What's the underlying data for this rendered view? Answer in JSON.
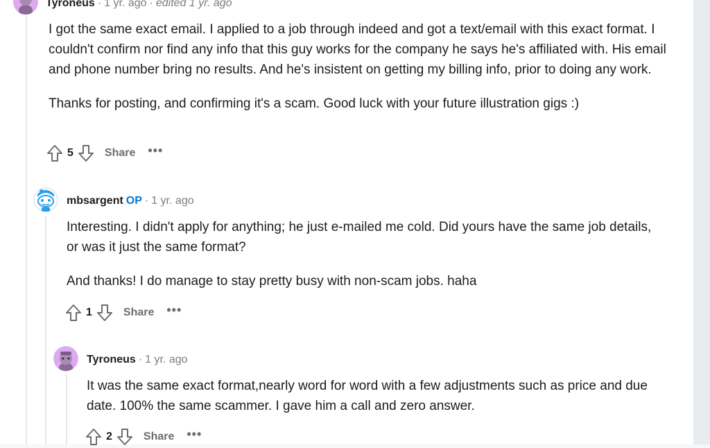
{
  "colors": {
    "accent": "#0079d3",
    "op_badge": "#0079d3",
    "thread_line": "#e5e7ea",
    "avatar_purple": "#ddaaf0"
  },
  "comments": [
    {
      "author": "Tyroneus",
      "time": "1 yr. ago",
      "edited": "edited 1 yr. ago",
      "avatar_icon": "snoo-purple-avatar-icon",
      "paragraphs": [
        "I got the same exact email. I applied to a job through indeed and got a text/email with this exact format. I couldn't confirm nor find any info that this guy works for the company he says he's affiliated with. His email and phone number bring no results. And he's insistent on getting my billing info, prior to doing any work.",
        "Thanks for posting, and confirming it's a scam. Good luck with your future illustration gigs :)"
      ],
      "score": "5",
      "share_label": "Share",
      "more_label": "•••"
    },
    {
      "author": "mbsargent",
      "op_label": "OP",
      "time": "1 yr. ago",
      "avatar_icon": "snoo-blue-avatar-icon",
      "paragraphs": [
        "Interesting. I didn't apply for anything; he just e-mailed me cold. Did yours have the same job details, or was it just the same format?",
        "And thanks! I do manage to stay pretty busy with non-scam jobs. haha"
      ],
      "score": "1",
      "share_label": "Share",
      "more_label": "•••"
    },
    {
      "author": "Tyroneus",
      "time": "1 yr. ago",
      "avatar_icon": "snoo-purple-avatar-icon",
      "paragraphs": [
        "It was the same exact format,nearly word for word with a few adjustments such as price and due date. 100% the same scammer. I gave him a call and zero answer."
      ],
      "score": "2",
      "share_label": "Share",
      "more_label": "•••"
    }
  ],
  "separator": "·"
}
